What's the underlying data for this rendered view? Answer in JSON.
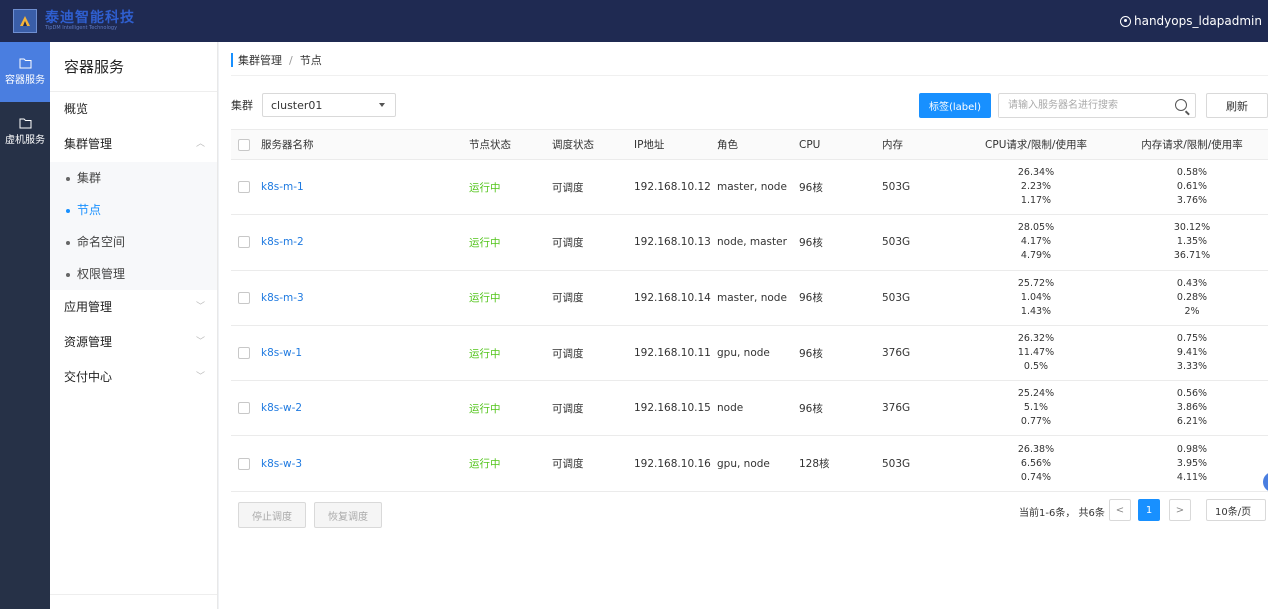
{
  "brand": {
    "name_cn": "泰迪智能科技",
    "name_en": "TipDM Intelligent Technology"
  },
  "user": {
    "name": "handyops_ldapadmin"
  },
  "rail": [
    {
      "label": "容器服务",
      "icon": "folder-icon",
      "active": true
    },
    {
      "label": "虚机服务",
      "icon": "folder-icon",
      "active": false
    }
  ],
  "sidebar": {
    "title": "容器服务",
    "overview": "概览",
    "cluster_mgmt": "集群管理",
    "sub": [
      "集群",
      "节点",
      "命名空间",
      "权限管理"
    ],
    "app_mgmt": "应用管理",
    "res_mgmt": "资源管理",
    "delivery": "交付中心"
  },
  "breadcrumb": {
    "parent": "集群管理",
    "sep": "/",
    "current": "节点"
  },
  "filter": {
    "label": "集群",
    "value": "cluster01"
  },
  "toolbar": {
    "label_button": "标签(label)",
    "search_placeholder": "请输入服务器名进行搜索",
    "refresh": "刷新"
  },
  "table": {
    "headers": {
      "name": "服务器名称",
      "status": "节点状态",
      "sched": "调度状态",
      "ip": "IP地址",
      "role": "角色",
      "cpu": "CPU",
      "mem": "内存",
      "cpu_usage": "CPU请求/限制/使用率",
      "mem_usage": "内存请求/限制/使用率"
    },
    "rows": [
      {
        "name": "k8s-m-1",
        "status": "运行中",
        "sched": "可调度",
        "ip": "192.168.10.12",
        "role": "master, node",
        "cpu": "96核",
        "mem": "503G",
        "cpu_u": [
          "26.34%",
          "2.23%",
          "1.17%"
        ],
        "mem_u": [
          "0.58%",
          "0.61%",
          "3.76%"
        ]
      },
      {
        "name": "k8s-m-2",
        "status": "运行中",
        "sched": "可调度",
        "ip": "192.168.10.13",
        "role": "node, master",
        "cpu": "96核",
        "mem": "503G",
        "cpu_u": [
          "28.05%",
          "4.17%",
          "4.79%"
        ],
        "mem_u": [
          "30.12%",
          "1.35%",
          "36.71%"
        ]
      },
      {
        "name": "k8s-m-3",
        "status": "运行中",
        "sched": "可调度",
        "ip": "192.168.10.14",
        "role": "master, node",
        "cpu": "96核",
        "mem": "503G",
        "cpu_u": [
          "25.72%",
          "1.04%",
          "1.43%"
        ],
        "mem_u": [
          "0.43%",
          "0.28%",
          "2%"
        ]
      },
      {
        "name": "k8s-w-1",
        "status": "运行中",
        "sched": "可调度",
        "ip": "192.168.10.11",
        "role": "gpu, node",
        "cpu": "96核",
        "mem": "376G",
        "cpu_u": [
          "26.32%",
          "11.47%",
          "0.5%"
        ],
        "mem_u": [
          "0.75%",
          "9.41%",
          "3.33%"
        ]
      },
      {
        "name": "k8s-w-2",
        "status": "运行中",
        "sched": "可调度",
        "ip": "192.168.10.15",
        "role": "node",
        "cpu": "96核",
        "mem": "376G",
        "cpu_u": [
          "25.24%",
          "5.1%",
          "0.77%"
        ],
        "mem_u": [
          "0.56%",
          "3.86%",
          "6.21%"
        ]
      },
      {
        "name": "k8s-w-3",
        "status": "运行中",
        "sched": "可调度",
        "ip": "192.168.10.16",
        "role": "gpu, node",
        "cpu": "128核",
        "mem": "503G",
        "cpu_u": [
          "26.38%",
          "6.56%",
          "0.74%"
        ],
        "mem_u": [
          "0.98%",
          "3.95%",
          "4.11%"
        ]
      }
    ]
  },
  "actions": {
    "stop": "停止调度",
    "resume": "恢复调度"
  },
  "pagination": {
    "total": "当前1-6条， 共6条",
    "prev": "<",
    "page": "1",
    "next": ">",
    "size": "10条/页"
  },
  "colors": {
    "topbar": "#1f2a52",
    "rail": "#263147",
    "accent": "#1890ff",
    "running": "#52c41a",
    "link": "#1f7ae0"
  }
}
